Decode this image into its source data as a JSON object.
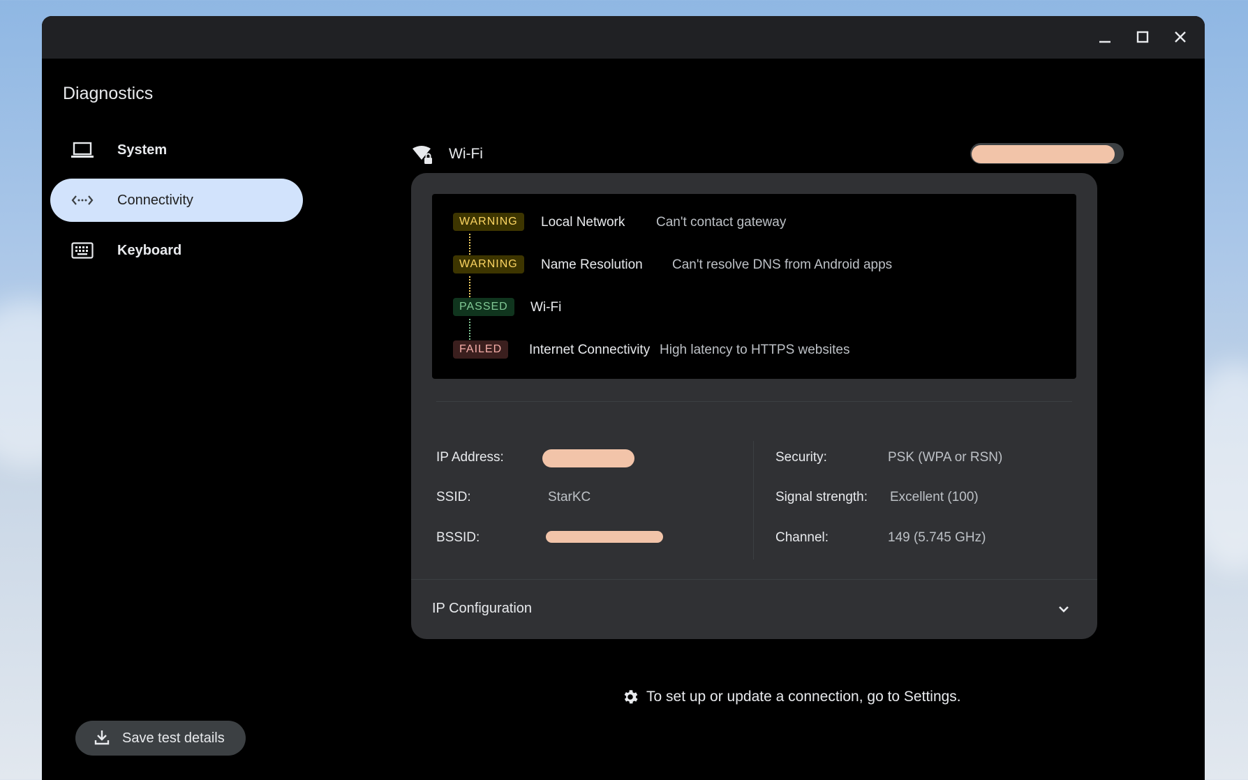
{
  "window": {
    "minimize_icon": "minimize-icon",
    "maximize_icon": "maximize-icon",
    "close_icon": "close-icon"
  },
  "app": {
    "title": "Diagnostics"
  },
  "sidebar": {
    "items": [
      {
        "label": "System",
        "icon": "laptop-icon",
        "active": false
      },
      {
        "label": "Connectivity",
        "icon": "connectivity-icon",
        "active": true
      },
      {
        "label": "Keyboard",
        "icon": "keyboard-icon",
        "active": false
      }
    ],
    "save_button": {
      "label": "Save test details",
      "icon": "download-icon"
    }
  },
  "network": {
    "type": "Wi-Fi",
    "icon": "wifi-lock-icon",
    "routines": [
      {
        "status": "WARNING",
        "name": "Local Network",
        "message": "Can't contact gateway"
      },
      {
        "status": "WARNING",
        "name": "Name Resolution",
        "message": "Can't resolve DNS from Android apps"
      },
      {
        "status": "PASSED",
        "name": "Wi-Fi",
        "message": ""
      },
      {
        "status": "FAILED",
        "name": "Internet Connectivity",
        "message": "High latency to HTTPS websites"
      }
    ],
    "properties_left": [
      {
        "label": "IP Address:",
        "value": ""
      },
      {
        "label": "SSID:",
        "value": "StarKC"
      },
      {
        "label": "BSSID:",
        "value": ""
      }
    ],
    "properties_right": [
      {
        "label": "Security:",
        "value": "PSK (WPA or RSN)"
      },
      {
        "label": "Signal strength:",
        "value": "Excellent (100)"
      },
      {
        "label": "Channel:",
        "value": "149 (5.745 GHz)"
      }
    ],
    "ip_configuration": {
      "label": "IP Configuration",
      "icon": "chevron-down-icon"
    }
  },
  "footer": {
    "settings_text": "To set up or update a connection, go to Settings.",
    "icon": "gear-icon"
  },
  "colors": {
    "warning": "#fdd663",
    "passed": "#81c995",
    "failed": "#f6aea9",
    "active_nav": "#d2e3fc",
    "card": "#303134"
  }
}
